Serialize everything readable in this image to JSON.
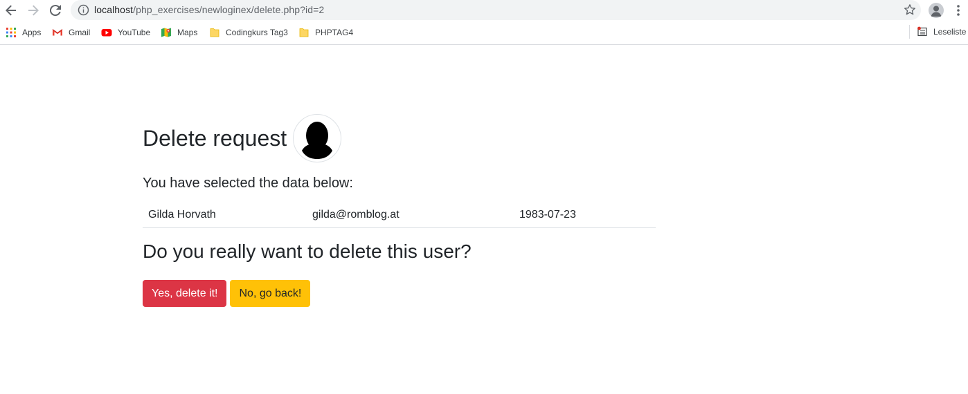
{
  "browser": {
    "url_host": "localhost",
    "url_path": "/php_exercises/newloginex/delete.php?id=2",
    "bookmarks": [
      {
        "label": "Apps",
        "icon": "apps-grid-icon"
      },
      {
        "label": "Gmail",
        "icon": "gmail-icon"
      },
      {
        "label": "YouTube",
        "icon": "youtube-icon"
      },
      {
        "label": "Maps",
        "icon": "maps-icon"
      },
      {
        "label": "Codingkurs Tag3",
        "icon": "folder-icon"
      },
      {
        "label": "PHPTAG4",
        "icon": "folder-icon"
      }
    ],
    "reading_list": "Leseliste"
  },
  "page": {
    "title": "Delete request",
    "subtitle": "You have selected the data below:",
    "record": {
      "name": "Gilda Horvath",
      "email": "gilda@romblog.at",
      "birthdate": "1983-07-23"
    },
    "question": "Do you really want to delete this user?",
    "confirm_label": "Yes, delete it!",
    "cancel_label": "No, go back!"
  },
  "colors": {
    "danger": "#dc3545",
    "warning": "#ffc107"
  }
}
